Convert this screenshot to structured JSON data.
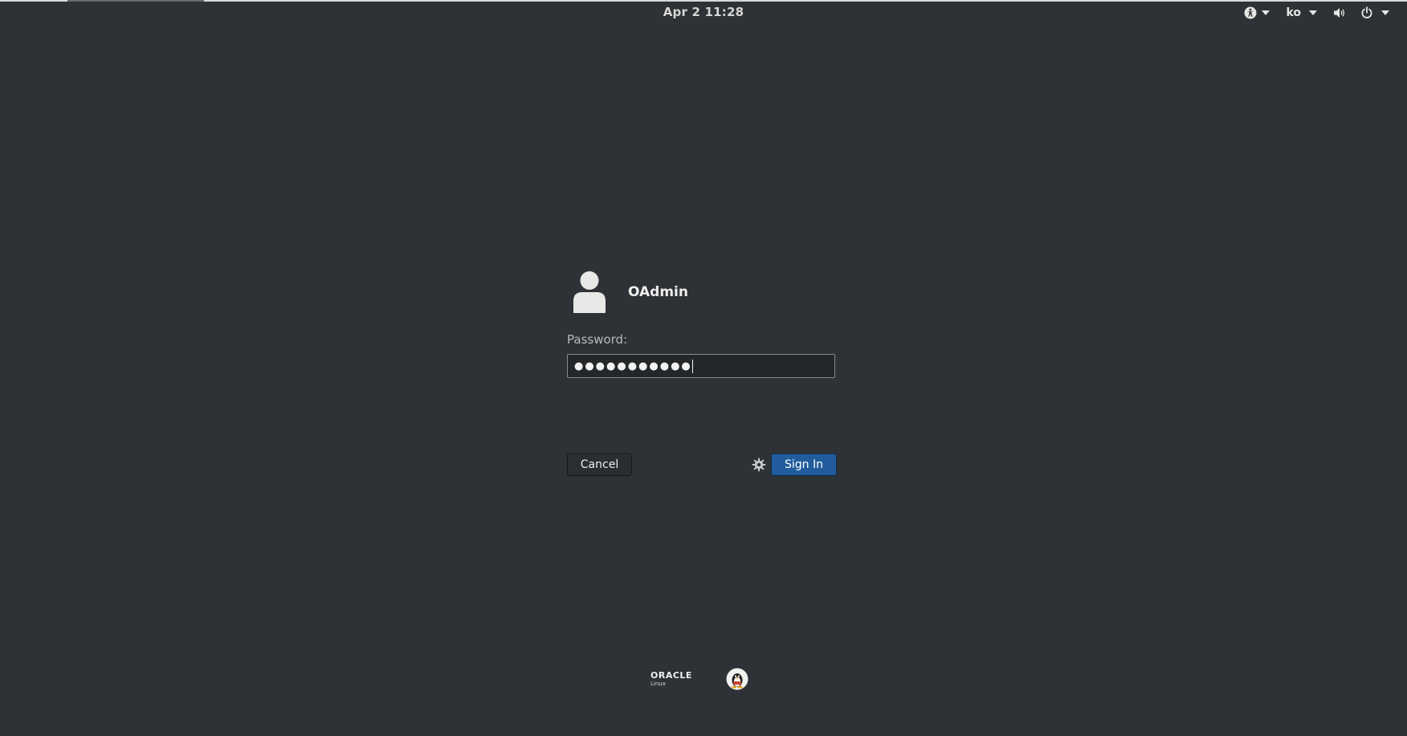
{
  "topbar": {
    "clock": "Apr 2  11:28",
    "language": "ko",
    "icons": {
      "accessibility": "accessibility-icon",
      "volume": "volume-icon",
      "power": "power-icon",
      "caret": "chevron-down-icon"
    }
  },
  "login": {
    "username": "OAdmin",
    "password_label": "Password:",
    "password_mask": "●●●●●●●●●●●",
    "cancel_label": "Cancel",
    "signin_label": "Sign In",
    "session_icon": "gear-icon",
    "avatar_icon": "user-avatar-icon"
  },
  "branding": {
    "logo_text": "ORACLE",
    "logo_subtext": "Linux",
    "mascot_icon": "tux-icon"
  },
  "colors": {
    "background": "#2e3236",
    "signin_button": "#215d9c",
    "field_background": "#242729"
  }
}
